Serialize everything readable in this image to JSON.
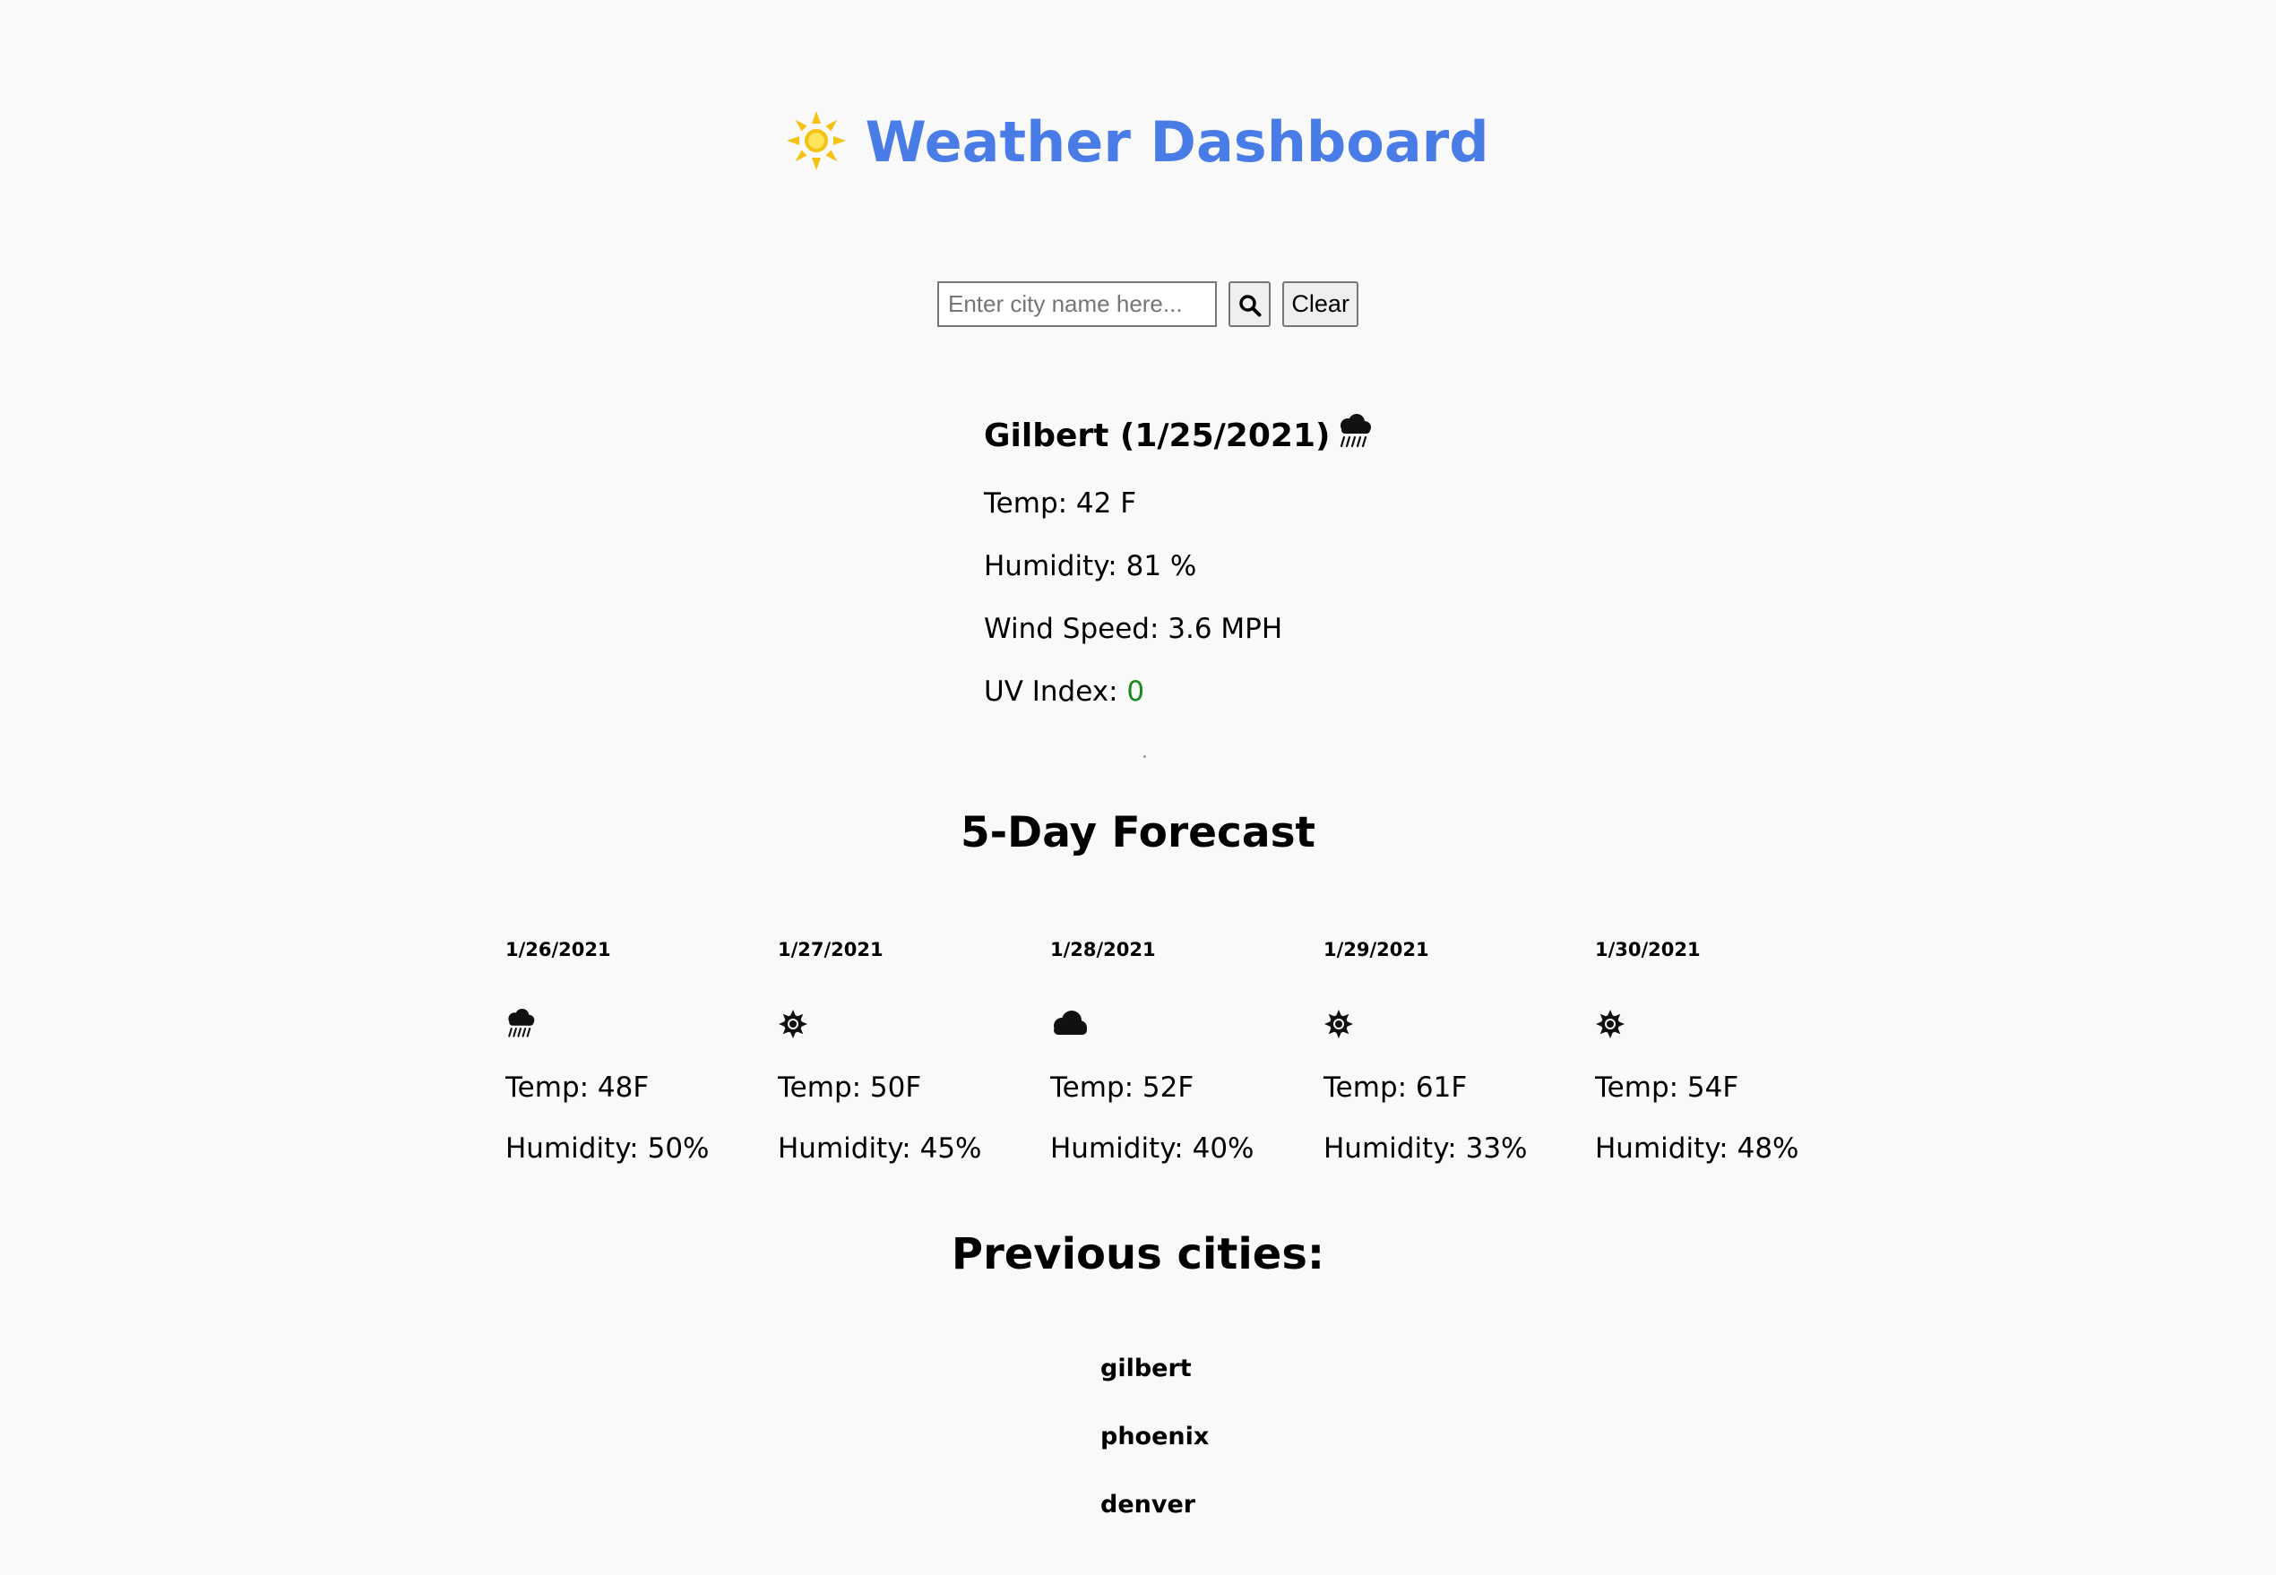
{
  "header": {
    "title": "Weather Dashboard",
    "icon": "sun-icon",
    "title_color": "#4a7ce8",
    "icon_color": "#f5c211"
  },
  "search": {
    "placeholder": "Enter city name here...",
    "value": "",
    "search_icon": "search-icon",
    "clear_label": "Clear"
  },
  "current": {
    "heading": "Gilbert (1/25/2021)",
    "icon": "rain-icon",
    "temp": "Temp: 42 F",
    "humidity": "Humidity: 81 %",
    "wind": "Wind Speed: 3.6 MPH",
    "uv_label": "UV Index: ",
    "uv_value": "0",
    "uv_color": "#1a8a1a"
  },
  "forecast": {
    "title": "5-Day Forecast",
    "days": [
      {
        "date": "1/26/2021",
        "icon": "rain-icon",
        "temp": "Temp: 48F",
        "humidity": "Humidity: 50%"
      },
      {
        "date": "1/27/2021",
        "icon": "sun-icon",
        "temp": "Temp: 50F",
        "humidity": "Humidity: 45%"
      },
      {
        "date": "1/28/2021",
        "icon": "cloud-icon",
        "temp": "Temp: 52F",
        "humidity": "Humidity: 40%"
      },
      {
        "date": "1/29/2021",
        "icon": "sun-icon",
        "temp": "Temp: 61F",
        "humidity": "Humidity: 33%"
      },
      {
        "date": "1/30/2021",
        "icon": "sun-icon",
        "temp": "Temp: 54F",
        "humidity": "Humidity: 48%"
      }
    ]
  },
  "previous": {
    "title": "Previous cities:",
    "cities": [
      "gilbert",
      "phoenix",
      "denver"
    ]
  }
}
